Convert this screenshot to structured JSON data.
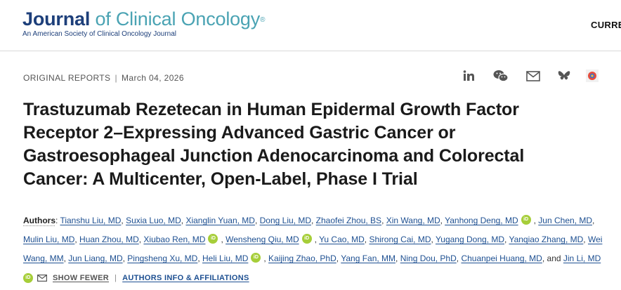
{
  "header": {
    "logo_journal": "Journal",
    "logo_rest": "of Clinical Oncology",
    "logo_reg": "®",
    "logo_sub": "An American Society of Clinical Oncology Journal",
    "nav_current": "CURREN"
  },
  "article": {
    "type": "ORIGINAL REPORTS",
    "separator": "|",
    "date": "March 04, 2026",
    "title_lines": [
      "Trastuzumab Rezetecan in Human Epidermal Growth Factor",
      "Receptor 2–Expressing Advanced Gastric Cancer or",
      "Gastroesophageal Junction Adenocarcinoma and Colorectal",
      "Cancer: A Multicenter, Open-Label, Phase I Trial"
    ]
  },
  "share_icons": [
    "linkedin-icon",
    "wechat-icon",
    "email-icon",
    "bluesky-icon",
    "altmetric-icon"
  ],
  "authors": {
    "label": "Authors",
    "names": [
      "Tianshu Liu, MD",
      "Suxia Luo, MD",
      "Xianglin Yuan, MD",
      "Dong Liu, MD",
      "Zhaofei Zhou, BS",
      "Xin Wang, MD",
      "Yanhong Deng, MD",
      "Jun Chen, MD",
      "Mulin Liu, MD",
      "Huan Zhou, MD",
      "Xiubao Ren, MD",
      "Wensheng Qiu, MD",
      "Yu Cao, MD",
      "Shirong Cai, MD",
      "Yugang Dong, MD",
      "Yanqiao Zhang, MD",
      "Wei Wang, MM",
      "Jun Liang, MD",
      "Pingsheng Xu, MD",
      "Heli Liu, MD",
      "Kaijing Zhao, PhD",
      "Yang Fan, MM",
      "Ning Dou, PhD",
      "Chuanpei Huang, MD",
      "Jin Li, MD"
    ],
    "name_fragments": {
      "wei": "Wei",
      "wang_mm": "Wang, MM"
    },
    "and": "and",
    "orcid": "iD",
    "show_fewer": "SHOW FEWER",
    "pipe": "|",
    "affiliations": "AUTHORS INFO & AFFILIATIONS"
  },
  "colors": {
    "brand": "#1d3f7a",
    "accent": "#4aa3b3",
    "link": "#1d4f91",
    "orcid": "#a6ce39"
  }
}
